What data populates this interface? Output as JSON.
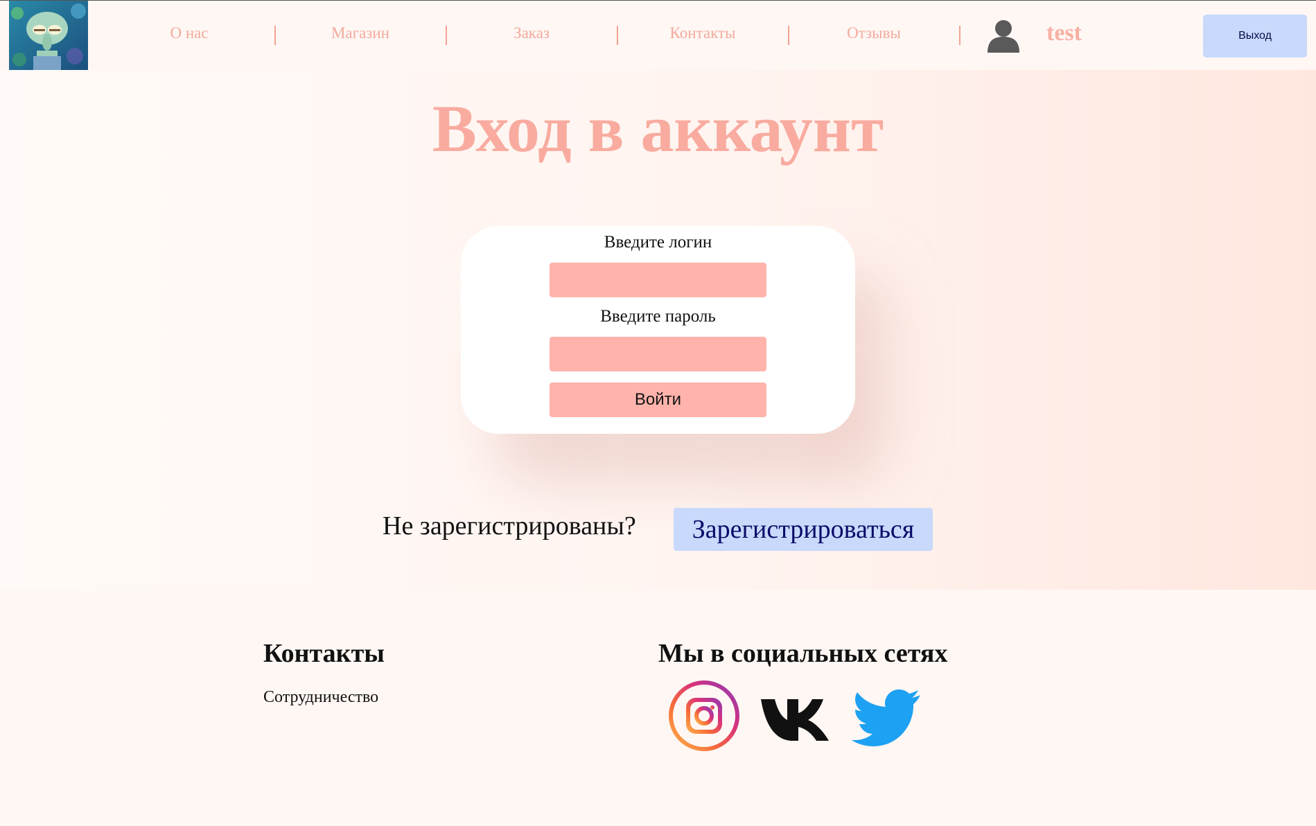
{
  "header": {
    "nav": [
      {
        "label": "О нас"
      },
      {
        "label": "Магазин"
      },
      {
        "label": "Заказ"
      },
      {
        "label": "Контакты"
      },
      {
        "label": "Отзывы"
      }
    ],
    "username": "test",
    "logout_label": "Выход",
    "logo_icon": "squidward-avatar-logo",
    "user_icon": "user-silhouette-icon"
  },
  "main": {
    "title": "Вход в аккаунт",
    "login_label": "Введите логин",
    "login_value": "",
    "password_label": "Введите пароль",
    "password_value": "",
    "submit_label": "Войти",
    "not_registered_text": "Не зарегистрированы?",
    "register_label": "Зарегистрироваться"
  },
  "footer": {
    "contacts_title": "Контакты",
    "contacts_link": "Сотрудничество",
    "social_title": "Мы в социальных сетях",
    "social": [
      {
        "icon": "instagram-icon"
      },
      {
        "icon": "vk-icon"
      },
      {
        "icon": "twitter-icon"
      }
    ]
  },
  "colors": {
    "accent_pink": "#f9ab9f",
    "input_pink": "#ffb3ab",
    "button_blue": "#c8d9fb"
  }
}
